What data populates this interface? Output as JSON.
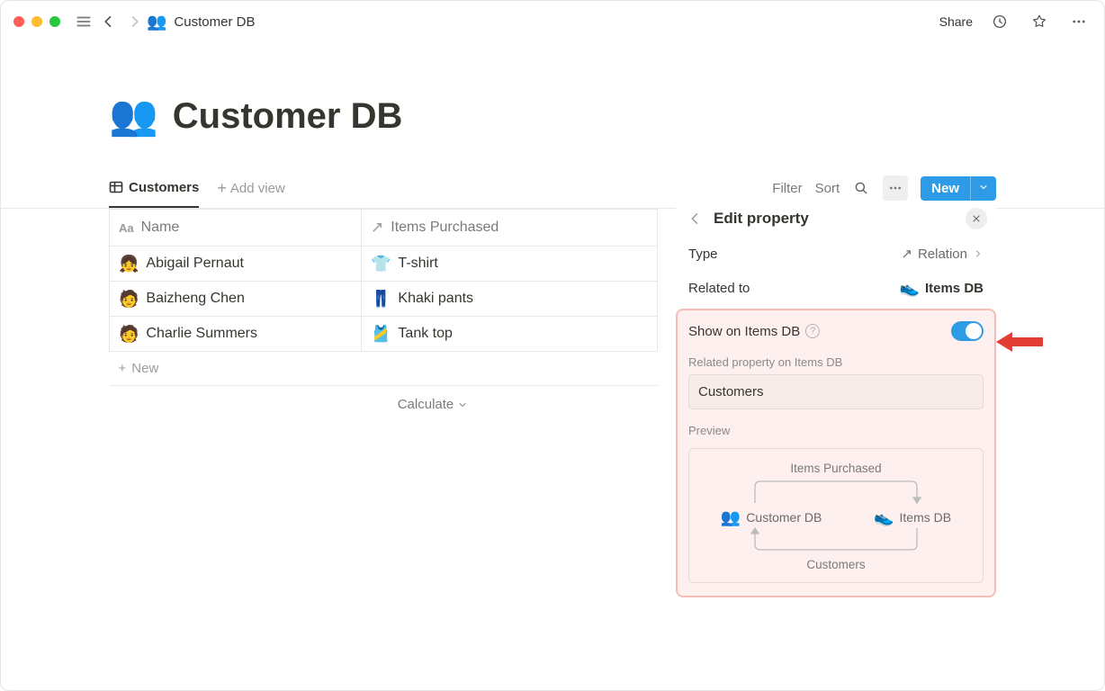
{
  "breadcrumb": {
    "icon": "👥",
    "title": "Customer DB"
  },
  "topbar": {
    "share": "Share"
  },
  "page": {
    "icon": "👥",
    "title": "Customer DB"
  },
  "views": {
    "active_tab": "Customers",
    "add_view": "Add view",
    "filter": "Filter",
    "sort": "Sort",
    "new": "New"
  },
  "table": {
    "columns": [
      {
        "icon": "Aa",
        "name": "Name"
      },
      {
        "icon": "↗",
        "name": "Items Purchased"
      }
    ],
    "rows": [
      {
        "avatar": "👧",
        "name": "Abigail Pernaut",
        "item_icon": "👕",
        "item": "T-shirt"
      },
      {
        "avatar": "🧑",
        "name": "Baizheng Chen",
        "item_icon": "👖",
        "item": "Khaki pants"
      },
      {
        "avatar": "🧑",
        "name": "Charlie Summers",
        "item_icon": "🎽",
        "item": "Tank top"
      }
    ],
    "new_row": "New",
    "calculate": "Calculate"
  },
  "panel": {
    "title": "Edit property",
    "type_label": "Type",
    "type_value": "Relation",
    "related_to_label": "Related to",
    "related_to_icon": "👟",
    "related_to_value": "Items DB",
    "show_on_label": "Show on Items DB",
    "show_on_toggle": true,
    "related_prop_heading": "Related property on Items DB",
    "related_prop_value": "Customers",
    "preview_heading": "Preview",
    "preview_top": "Items Purchased",
    "preview_left_icon": "👥",
    "preview_left": "Customer DB",
    "preview_right_icon": "👟",
    "preview_right": "Items DB",
    "preview_bottom": "Customers"
  }
}
